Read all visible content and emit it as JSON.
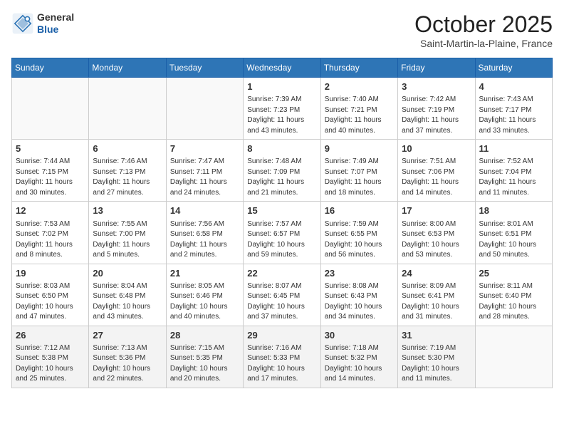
{
  "logo": {
    "line1": "General",
    "line2": "Blue"
  },
  "header": {
    "month": "October 2025",
    "location": "Saint-Martin-la-Plaine, France"
  },
  "days_of_week": [
    "Sunday",
    "Monday",
    "Tuesday",
    "Wednesday",
    "Thursday",
    "Friday",
    "Saturday"
  ],
  "weeks": [
    [
      {
        "day": "",
        "info": ""
      },
      {
        "day": "",
        "info": ""
      },
      {
        "day": "",
        "info": ""
      },
      {
        "day": "1",
        "info": "Sunrise: 7:39 AM\nSunset: 7:23 PM\nDaylight: 11 hours and 43 minutes."
      },
      {
        "day": "2",
        "info": "Sunrise: 7:40 AM\nSunset: 7:21 PM\nDaylight: 11 hours and 40 minutes."
      },
      {
        "day": "3",
        "info": "Sunrise: 7:42 AM\nSunset: 7:19 PM\nDaylight: 11 hours and 37 minutes."
      },
      {
        "day": "4",
        "info": "Sunrise: 7:43 AM\nSunset: 7:17 PM\nDaylight: 11 hours and 33 minutes."
      }
    ],
    [
      {
        "day": "5",
        "info": "Sunrise: 7:44 AM\nSunset: 7:15 PM\nDaylight: 11 hours and 30 minutes."
      },
      {
        "day": "6",
        "info": "Sunrise: 7:46 AM\nSunset: 7:13 PM\nDaylight: 11 hours and 27 minutes."
      },
      {
        "day": "7",
        "info": "Sunrise: 7:47 AM\nSunset: 7:11 PM\nDaylight: 11 hours and 24 minutes."
      },
      {
        "day": "8",
        "info": "Sunrise: 7:48 AM\nSunset: 7:09 PM\nDaylight: 11 hours and 21 minutes."
      },
      {
        "day": "9",
        "info": "Sunrise: 7:49 AM\nSunset: 7:07 PM\nDaylight: 11 hours and 18 minutes."
      },
      {
        "day": "10",
        "info": "Sunrise: 7:51 AM\nSunset: 7:06 PM\nDaylight: 11 hours and 14 minutes."
      },
      {
        "day": "11",
        "info": "Sunrise: 7:52 AM\nSunset: 7:04 PM\nDaylight: 11 hours and 11 minutes."
      }
    ],
    [
      {
        "day": "12",
        "info": "Sunrise: 7:53 AM\nSunset: 7:02 PM\nDaylight: 11 hours and 8 minutes."
      },
      {
        "day": "13",
        "info": "Sunrise: 7:55 AM\nSunset: 7:00 PM\nDaylight: 11 hours and 5 minutes."
      },
      {
        "day": "14",
        "info": "Sunrise: 7:56 AM\nSunset: 6:58 PM\nDaylight: 11 hours and 2 minutes."
      },
      {
        "day": "15",
        "info": "Sunrise: 7:57 AM\nSunset: 6:57 PM\nDaylight: 10 hours and 59 minutes."
      },
      {
        "day": "16",
        "info": "Sunrise: 7:59 AM\nSunset: 6:55 PM\nDaylight: 10 hours and 56 minutes."
      },
      {
        "day": "17",
        "info": "Sunrise: 8:00 AM\nSunset: 6:53 PM\nDaylight: 10 hours and 53 minutes."
      },
      {
        "day": "18",
        "info": "Sunrise: 8:01 AM\nSunset: 6:51 PM\nDaylight: 10 hours and 50 minutes."
      }
    ],
    [
      {
        "day": "19",
        "info": "Sunrise: 8:03 AM\nSunset: 6:50 PM\nDaylight: 10 hours and 47 minutes."
      },
      {
        "day": "20",
        "info": "Sunrise: 8:04 AM\nSunset: 6:48 PM\nDaylight: 10 hours and 43 minutes."
      },
      {
        "day": "21",
        "info": "Sunrise: 8:05 AM\nSunset: 6:46 PM\nDaylight: 10 hours and 40 minutes."
      },
      {
        "day": "22",
        "info": "Sunrise: 8:07 AM\nSunset: 6:45 PM\nDaylight: 10 hours and 37 minutes."
      },
      {
        "day": "23",
        "info": "Sunrise: 8:08 AM\nSunset: 6:43 PM\nDaylight: 10 hours and 34 minutes."
      },
      {
        "day": "24",
        "info": "Sunrise: 8:09 AM\nSunset: 6:41 PM\nDaylight: 10 hours and 31 minutes."
      },
      {
        "day": "25",
        "info": "Sunrise: 8:11 AM\nSunset: 6:40 PM\nDaylight: 10 hours and 28 minutes."
      }
    ],
    [
      {
        "day": "26",
        "info": "Sunrise: 7:12 AM\nSunset: 5:38 PM\nDaylight: 10 hours and 25 minutes."
      },
      {
        "day": "27",
        "info": "Sunrise: 7:13 AM\nSunset: 5:36 PM\nDaylight: 10 hours and 22 minutes."
      },
      {
        "day": "28",
        "info": "Sunrise: 7:15 AM\nSunset: 5:35 PM\nDaylight: 10 hours and 20 minutes."
      },
      {
        "day": "29",
        "info": "Sunrise: 7:16 AM\nSunset: 5:33 PM\nDaylight: 10 hours and 17 minutes."
      },
      {
        "day": "30",
        "info": "Sunrise: 7:18 AM\nSunset: 5:32 PM\nDaylight: 10 hours and 14 minutes."
      },
      {
        "day": "31",
        "info": "Sunrise: 7:19 AM\nSunset: 5:30 PM\nDaylight: 10 hours and 11 minutes."
      },
      {
        "day": "",
        "info": ""
      }
    ]
  ]
}
